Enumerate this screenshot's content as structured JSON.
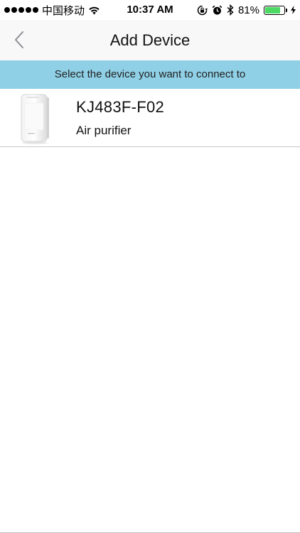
{
  "status_bar": {
    "carrier": "中国移动",
    "time": "10:37 AM",
    "battery_percent": "81%",
    "battery_level": 0.81,
    "battery_color": "#4cd964",
    "icons": [
      "signal-dots-icon",
      "wifi-icon",
      "rotation-lock-icon",
      "alarm-icon",
      "bluetooth-icon",
      "battery-icon",
      "charging-bolt-icon"
    ]
  },
  "nav": {
    "title": "Add Device",
    "back_icon": "chevron-left-icon"
  },
  "banner": {
    "text": "Select the device you want to connect to",
    "background": "#8fd0e6"
  },
  "devices": [
    {
      "name": "KJ483F-F02",
      "type": "Air purifier",
      "thumbnail_icon": "air-purifier-icon"
    }
  ]
}
